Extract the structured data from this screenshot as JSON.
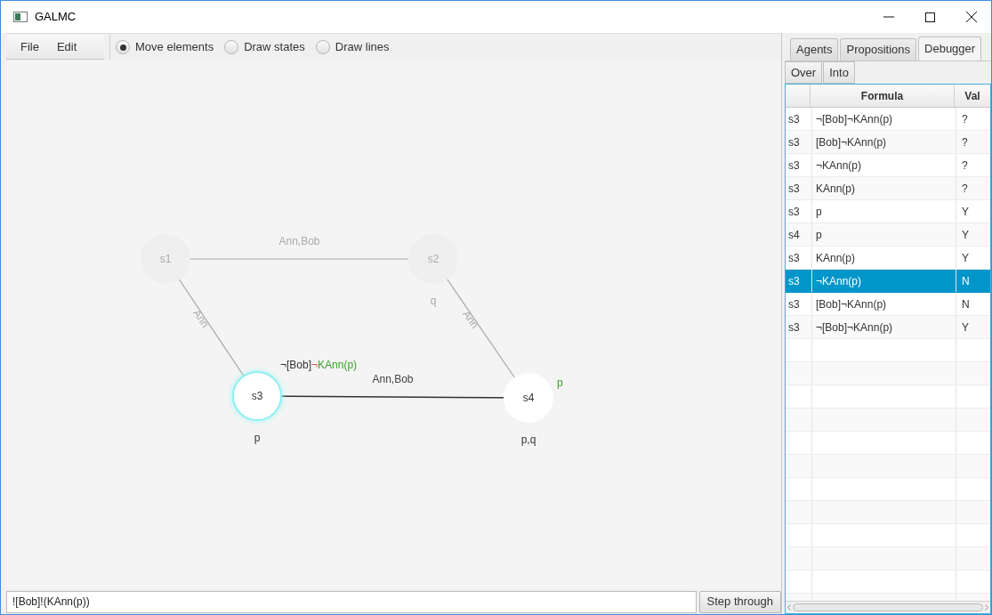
{
  "window": {
    "title": "GALMC"
  },
  "menu": [
    "File",
    "Edit"
  ],
  "modes": [
    {
      "label": "Move elements",
      "selected": true
    },
    {
      "label": "Draw states",
      "selected": false
    },
    {
      "label": "Draw lines",
      "selected": false
    }
  ],
  "graph": {
    "states": [
      {
        "name": "s1",
        "faded": true,
        "highlighted": false
      },
      {
        "name": "s2",
        "props": "q",
        "faded": true,
        "highlighted": false
      },
      {
        "name": "s3",
        "props": "p",
        "faded": false,
        "highlighted": true,
        "formula": [
          {
            "text": "¬[Bob]",
            "color": "#333333"
          },
          {
            "text": "¬",
            "color": "#e0504a"
          },
          {
            "text": "KAnn(p)",
            "color": "#3aa02c"
          }
        ]
      },
      {
        "name": "s4",
        "props": "p,q",
        "faded": false,
        "highlighted": false,
        "valuation": {
          "text": "p",
          "color": "#3aa02c"
        }
      }
    ],
    "edges": [
      {
        "label": "Ann,Bob",
        "faded": true
      },
      {
        "label": "Ann",
        "faded": true
      },
      {
        "label": "Ann",
        "faded": true
      },
      {
        "label": "Ann,Bob",
        "faded": false
      }
    ]
  },
  "formula_input": {
    "value": "![Bob]!(KAnn(p))"
  },
  "step_button": "Step through",
  "tabs": [
    {
      "label": "Agents",
      "selected": false
    },
    {
      "label": "Propositions",
      "selected": false
    },
    {
      "label": "Debugger",
      "selected": true
    }
  ],
  "debug_buttons": [
    "Over",
    "Into"
  ],
  "table": {
    "columns": [
      "Formula",
      "Val"
    ],
    "rows": [
      {
        "state": "s3",
        "formula": "¬[Bob]¬KAnn(p)",
        "val": "?",
        "selected": false
      },
      {
        "state": "s3",
        "formula": "[Bob]¬KAnn(p)",
        "val": "?",
        "selected": false
      },
      {
        "state": "s3",
        "formula": "¬KAnn(p)",
        "val": "?",
        "selected": false
      },
      {
        "state": "s3",
        "formula": "KAnn(p)",
        "val": "?",
        "selected": false
      },
      {
        "state": "s3",
        "formula": "p",
        "val": "Y",
        "selected": false
      },
      {
        "state": "s4",
        "formula": "p",
        "val": "Y",
        "selected": false
      },
      {
        "state": "s3",
        "formula": "KAnn(p)",
        "val": "Y",
        "selected": false
      },
      {
        "state": "s3",
        "formula": "¬KAnn(p)",
        "val": "N",
        "selected": true
      },
      {
        "state": "s3",
        "formula": "[Bob]¬KAnn(p)",
        "val": "N",
        "selected": false
      },
      {
        "state": "s3",
        "formula": "¬[Bob]¬KAnn(p)",
        "val": "Y",
        "selected": false
      }
    ]
  }
}
